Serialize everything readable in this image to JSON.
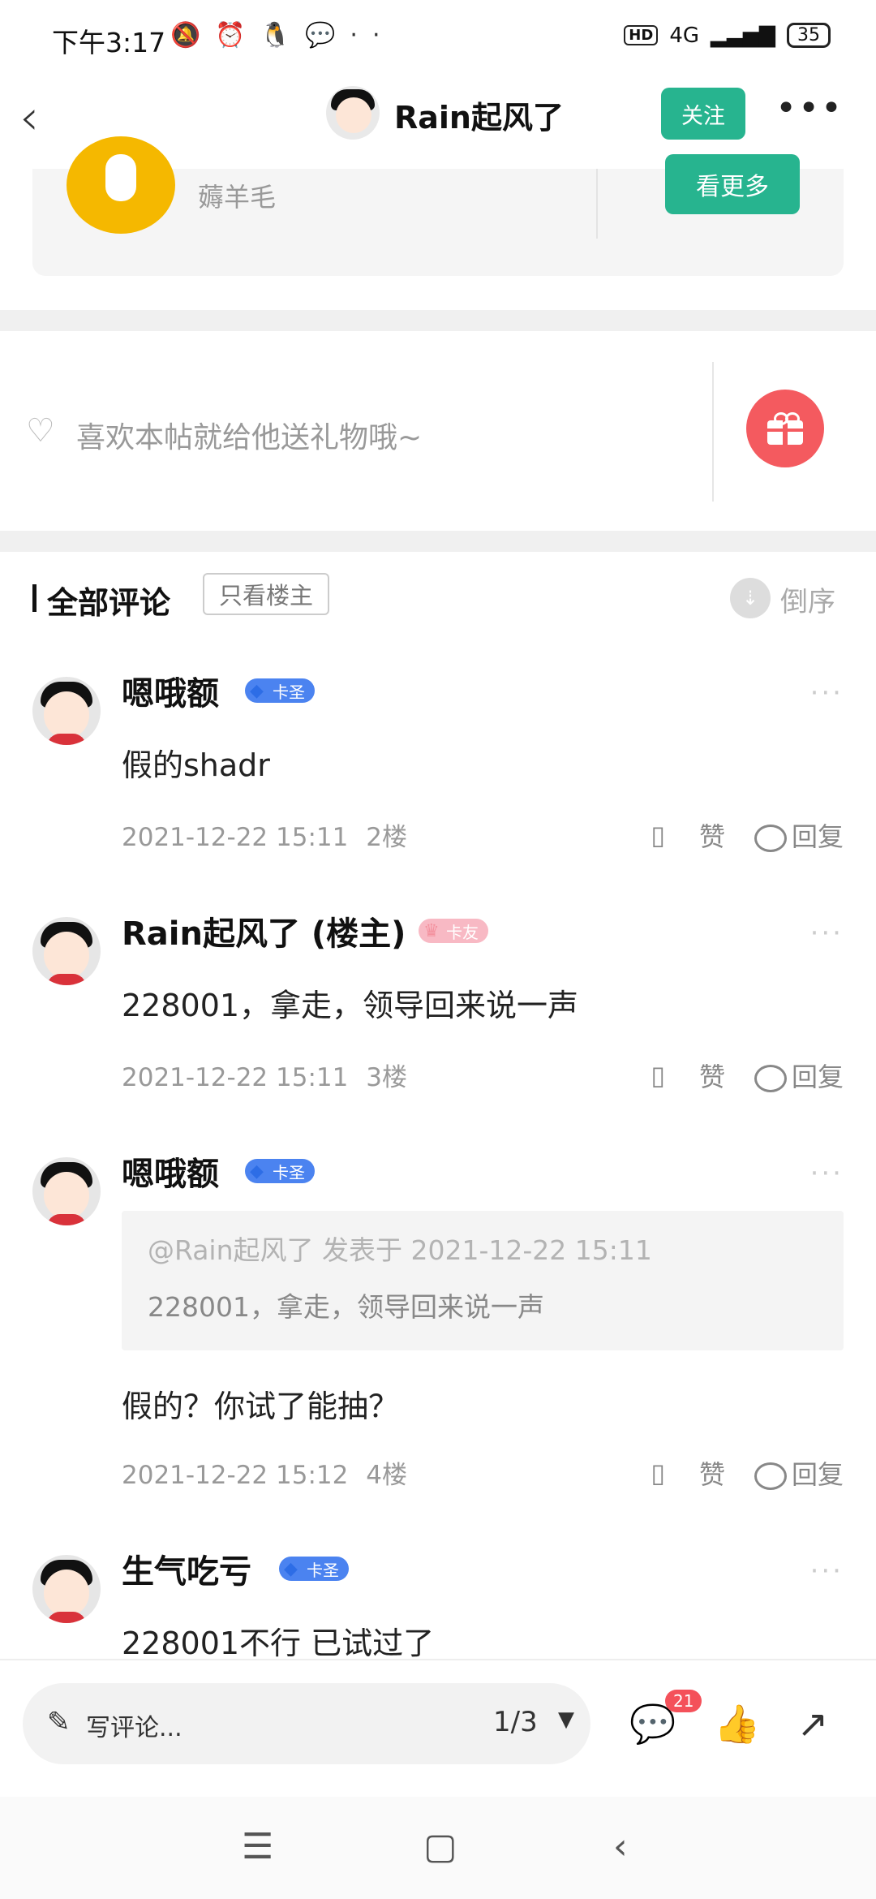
{
  "status_bar": {
    "time": "下午3:17",
    "network": "4G",
    "hd": "HD",
    "battery": "35"
  },
  "header": {
    "title": "Rain起风了",
    "follow_label": "关注",
    "more_icon": "more-horizontal-icon"
  },
  "card": {
    "subtitle": "薅羊毛",
    "button": "看更多",
    "accent": "#27b48f"
  },
  "gift": {
    "prompt": "喜欢本帖就给他送礼物哦~",
    "button_color": "#f45a5f"
  },
  "comments_section": {
    "title": "全部评论",
    "filter_label": "只看楼主",
    "sort_label": "倒序"
  },
  "comments": [
    {
      "user": "嗯哦额",
      "badge": "卡圣",
      "text": "假的shadr",
      "time": "2021-12-22 15:11",
      "floor": "2楼",
      "like_label": "赞",
      "reply_label": "回复"
    },
    {
      "user": "Rain起风了 (楼主)",
      "badge": "卡友",
      "text": "228001，拿走，领导回来说一声",
      "time": "2021-12-22 15:11",
      "floor": "3楼",
      "like_label": "赞",
      "reply_label": "回复"
    },
    {
      "user": "嗯哦额",
      "badge": "卡圣",
      "quote_header": "@Rain起风了 发表于 2021-12-22 15:11",
      "quote_body": "228001，拿走，领导回来说一声",
      "text": "假的？你试了能抽？",
      "time": "2021-12-22 15:12",
      "floor": "4楼",
      "like_label": "赞",
      "reply_label": "回复"
    },
    {
      "user": "生气吃亏",
      "badge": "卡圣",
      "text": "228001不行 已试过了"
    }
  ],
  "bottom_bar": {
    "write_placeholder": "写评论...",
    "page": "1/3",
    "comment_count": "21"
  }
}
